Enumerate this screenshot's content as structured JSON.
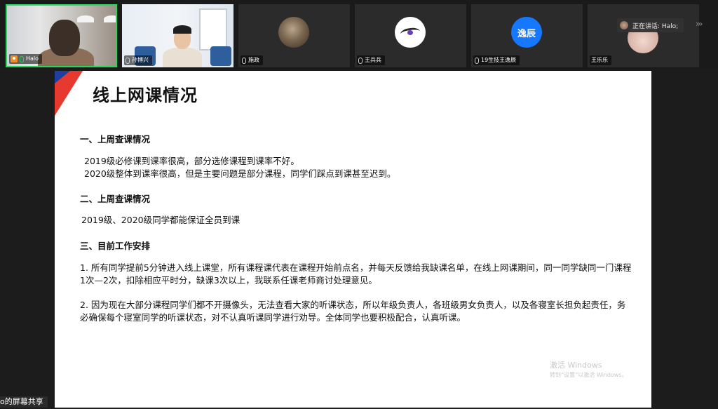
{
  "participants": [
    {
      "name": "Halo",
      "mic_active": true
    },
    {
      "name": "孙博兴"
    },
    {
      "name": "施政"
    },
    {
      "name": "王兵兵"
    },
    {
      "name": "19生技王逸辰",
      "avatar_text": "逸辰"
    },
    {
      "name": "王乐乐"
    }
  ],
  "speaking_indicator": "正在讲话: Halo;",
  "slide": {
    "title": "线上网课情况",
    "section1_heading": "一、上周查课情况",
    "section1_lines": [
      "2019级必修课到课率很高，部分选修课程到课率不好。",
      "2020级整体到课率很高，但是主要问题是部分课程，同学们踩点到课甚至迟到。"
    ],
    "section2_heading": "二、上周查课情况",
    "section2_text": "2019级、2020级同学都能保证全员到课",
    "section3_heading": "三、目前工作安排",
    "item1": "1. 所有同学提前5分钟进入线上课堂，所有课程课代表在课程开始前点名，并每天反馈给我缺课名单，在线上网课期间，同一同学缺同一门课程1次—2次，扣除相应平时分，缺课3次以上，我联系任课老师商讨处理意见。",
    "item2": "2. 因为现在大部分课程同学们都不开摄像头，无法查看大家的听课状态，所以年级负责人，各班级男女负责人，以及各寝室长担负起责任，务必确保每个寝室同学的听课状态，对不认真听课同学进行劝导。全体同学也要积极配合，认真听课。"
  },
  "watermark": {
    "line1": "激活 Windows",
    "line2": "转到“设置”以激活 Windows。"
  },
  "share_label": "o的屏幕共享",
  "colors": {
    "active_border": "#23d959",
    "accent_red": "#e63a2e",
    "accent_blue": "#1f3fa0",
    "avatar_blue": "#1677ff"
  }
}
